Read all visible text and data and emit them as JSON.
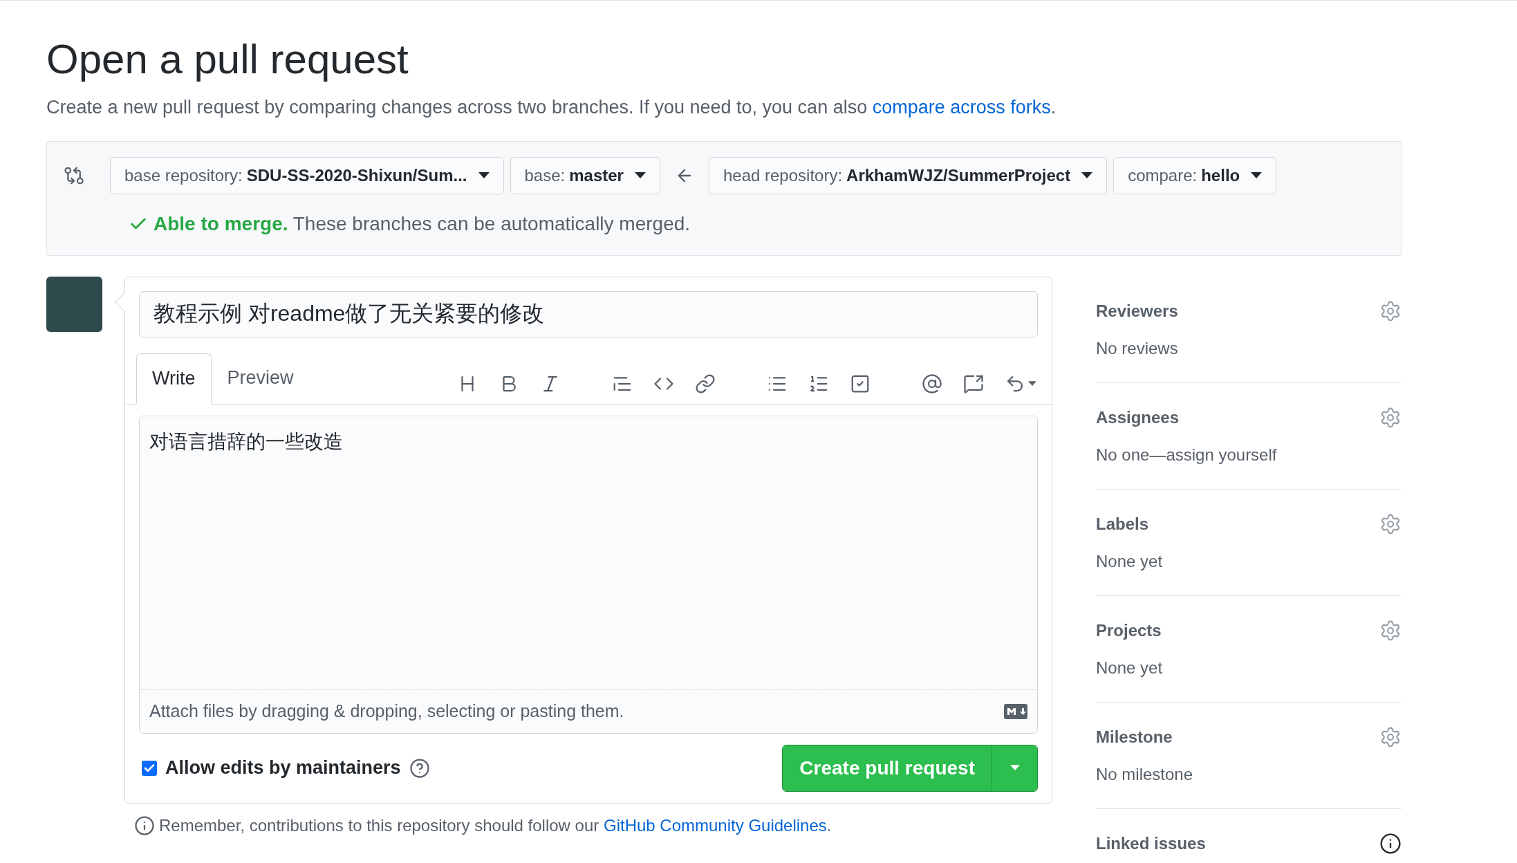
{
  "title": "Open a pull request",
  "subtitle": {
    "text": "Create a new pull request by comparing changes across two branches. If you need to, you can also ",
    "link": "compare across forks",
    "end": "."
  },
  "compare": {
    "selectors": [
      {
        "label": "base repository:",
        "value": "SDU-SS-2020-Shixun/Sum..."
      },
      {
        "label": "base:",
        "value": "master"
      },
      {
        "label": "head repository:",
        "value": "ArkhamWJZ/SummerProject"
      },
      {
        "label": "compare:",
        "value": "hello"
      }
    ],
    "status": {
      "mergeable": true,
      "headline": "Able to merge.",
      "text": "These branches can be automatically merged."
    }
  },
  "form": {
    "title_value": "教程示例 对readme做了无关紧要的修改",
    "tabs": [
      {
        "label": "Write",
        "selected": true
      },
      {
        "label": "Preview",
        "selected": false
      }
    ],
    "body_value": "对语言措辞的一些改造",
    "attach_hint": "Attach files by dragging & dropping, selecting or pasting them.",
    "allow_edits": {
      "label": "Allow edits by maintainers",
      "checked": true
    },
    "submit": "Create pull request"
  },
  "notice": {
    "text": "Remember, contributions to this repository should follow our ",
    "link": "GitHub Community Guidelines",
    "end": "."
  },
  "sidebar": [
    {
      "kind": "settings",
      "heading": "Reviewers",
      "value": "No reviews"
    },
    {
      "kind": "settings",
      "heading": "Assignees",
      "value": "No one—assign yourself"
    },
    {
      "kind": "settings",
      "heading": "Labels",
      "value": "None yet"
    },
    {
      "kind": "settings",
      "heading": "Projects",
      "value": "None yet"
    },
    {
      "kind": "settings",
      "heading": "Milestone",
      "value": "No milestone"
    },
    {
      "kind": "info",
      "heading": "Linked issues"
    }
  ]
}
